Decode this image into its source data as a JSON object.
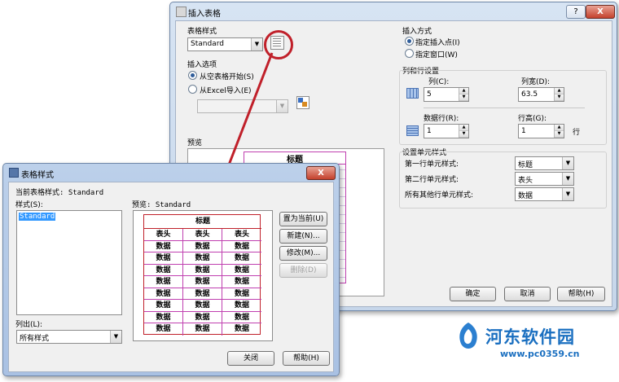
{
  "insert_dialog": {
    "title": "插入表格",
    "help_btn": "?",
    "close_btn": "X",
    "table_style_group": "表格样式",
    "table_style_value": "Standard",
    "insert_options_group": "插入选项",
    "opt_empty": "从空表格开始(S)",
    "opt_excel": "从Excel导入(E)",
    "preview_label": "预览",
    "preview_title": "标题",
    "insert_mode_group": "插入方式",
    "mode_point": "指定插入点(I)",
    "mode_window": "指定窗口(W)",
    "rowcol_group": "列和行设置",
    "cols_label": "列(C):",
    "cols_value": "5",
    "colwidth_label": "列宽(D):",
    "colwidth_value": "63.5",
    "datarows_label": "数据行(R):",
    "datarows_value": "1",
    "rowheight_label": "行高(G):",
    "rowheight_value": "1",
    "row_unit": "行",
    "cellstyle_group": "设置单元样式",
    "first_row_label": "第一行单元样式:",
    "first_row_value": "标题",
    "second_row_label": "第二行单元样式:",
    "second_row_value": "表头",
    "other_rows_label": "所有其他行单元样式:",
    "other_rows_value": "数据",
    "ok_btn": "确定",
    "cancel_btn": "取消",
    "help_btn2": "帮助(H)"
  },
  "style_dialog": {
    "title": "表格样式",
    "close_btn": "X",
    "current_style": "当前表格样式: Standard",
    "styles_label": "样式(S):",
    "styles_list": [
      "Standard"
    ],
    "preview_label": "预览: Standard",
    "list_label": "列出(L):",
    "list_value": "所有样式",
    "set_current_btn": "置为当前(U)",
    "new_btn": "新建(N)...",
    "modify_btn": "修改(M)...",
    "delete_btn": "删除(D)",
    "close_btn2": "关闭",
    "help_btn": "帮助(H)",
    "preview_table": {
      "title": "标题",
      "header": [
        "表头",
        "表头",
        "表头"
      ],
      "cell": "数据",
      "rows": 8
    }
  },
  "watermark": {
    "site_name": "河东软件园",
    "url": "www.pc0359.cn"
  },
  "colors": {
    "accent_red": "#c0202a",
    "grid_magenta": "#c040b0",
    "titlebar_blue": "#c9daef",
    "watermark_blue": "#1a6fc0"
  }
}
